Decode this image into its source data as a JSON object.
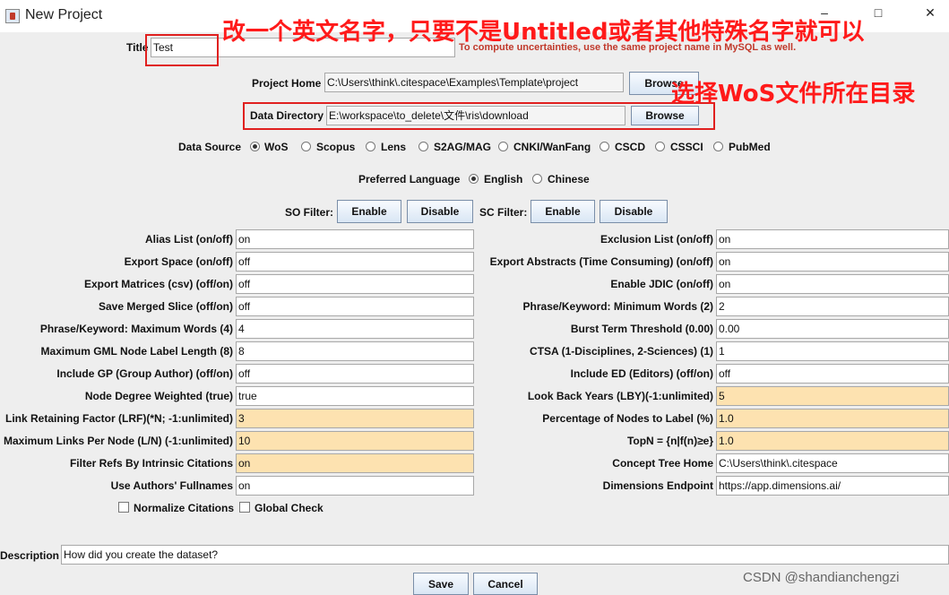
{
  "window": {
    "title": "New Project",
    "minimize": "–",
    "maximize": "□",
    "close": "✕"
  },
  "title_field": {
    "label": "Title",
    "value": "Test",
    "hint": "To compute uncertainties, use the same project name in MySQL as well."
  },
  "project_home": {
    "label": "Project Home",
    "value": "C:\\Users\\think\\.citespace\\Examples\\Template\\project",
    "browse": "Browse"
  },
  "data_directory": {
    "label": "Data Directory",
    "value": "E:\\workspace\\to_delete\\文件\\ris\\download",
    "browse": "Browse"
  },
  "data_source": {
    "label": "Data Source",
    "selected": "WoS",
    "options": [
      "WoS",
      "Scopus",
      "Lens",
      "S2AG/MAG",
      "CNKI/WanFang",
      "CSCD",
      "CSSCI",
      "PubMed"
    ]
  },
  "language": {
    "label": "Preferred Language",
    "selected": "English",
    "options": [
      "English",
      "Chinese"
    ]
  },
  "filters": {
    "so_label": "SO Filter:",
    "sc_label": "SC Filter:",
    "enable": "Enable",
    "disable": "Disable"
  },
  "left_params": [
    {
      "label": "Alias List (on/off)",
      "value": "on",
      "highlight": false
    },
    {
      "label": "Export Space (on/off)",
      "value": "off",
      "highlight": false
    },
    {
      "label": "Export Matrices (csv) (off/on)",
      "value": "off",
      "highlight": false
    },
    {
      "label": "Save Merged Slice (off/on)",
      "value": "off",
      "highlight": false
    },
    {
      "label": "Phrase/Keyword: Maximum Words (4)",
      "value": "4",
      "highlight": false
    },
    {
      "label": "Maximum GML Node Label Length (8)",
      "value": "8",
      "highlight": false
    },
    {
      "label": "Include GP (Group Author) (off/on)",
      "value": "off",
      "highlight": false
    },
    {
      "label": "Node Degree Weighted (true)",
      "value": "true",
      "highlight": false
    },
    {
      "label": "Link Retaining Factor (LRF)(*N; -1:unlimited)",
      "value": "3",
      "highlight": true
    },
    {
      "label": "Maximum Links Per Node (L/N) (-1:unlimited)",
      "value": "10",
      "highlight": true
    },
    {
      "label": "Filter Refs By Intrinsic Citations",
      "value": "on",
      "highlight": true
    },
    {
      "label": "Use Authors' Fullnames",
      "value": "on",
      "highlight": false
    }
  ],
  "right_params": [
    {
      "label": "Exclusion List (on/off)",
      "value": "on",
      "highlight": false
    },
    {
      "label": "Export Abstracts (Time Consuming) (on/off)",
      "value": "on",
      "highlight": false
    },
    {
      "label": "Enable JDIC (on/off)",
      "value": "on",
      "highlight": false
    },
    {
      "label": "Phrase/Keyword: Minimum Words (2)",
      "value": "2",
      "highlight": false
    },
    {
      "label": "Burst Term Threshold (0.00)",
      "value": "0.00",
      "highlight": false
    },
    {
      "label": "CTSA (1-Disciplines, 2-Sciences) (1)",
      "value": "1",
      "highlight": false
    },
    {
      "label": "Include ED (Editors) (off/on)",
      "value": "off",
      "highlight": false
    },
    {
      "label": "Look Back Years (LBY)(-1:unlimited)",
      "value": "5",
      "highlight": true
    },
    {
      "label": "Percentage of Nodes to Label (%)",
      "value": "1.0",
      "highlight": true
    },
    {
      "label": "TopN = {n|f(n)≥e}",
      "value": "1.0",
      "highlight": true
    },
    {
      "label": "Concept Tree Home",
      "value": "C:\\Users\\think\\.citespace",
      "highlight": false
    },
    {
      "label": "Dimensions Endpoint",
      "value": "https://app.dimensions.ai/",
      "highlight": false
    }
  ],
  "checkboxes": {
    "normalize": "Normalize Citations",
    "global": "Global Check"
  },
  "description": {
    "label": "Description",
    "value": "How did you create the dataset?"
  },
  "actions": {
    "save": "Save",
    "cancel": "Cancel"
  },
  "annotations": {
    "title_note": "改一个英文名字，只要不是Untitled或者其他特殊名字就可以",
    "dir_note": "选择WoS文件所在目录"
  },
  "watermark": "CSDN @shandianchengzi",
  "colors": {
    "highlight": "#fde2b0",
    "annotation": "#ff1a1a",
    "hint": "#c0392b"
  }
}
